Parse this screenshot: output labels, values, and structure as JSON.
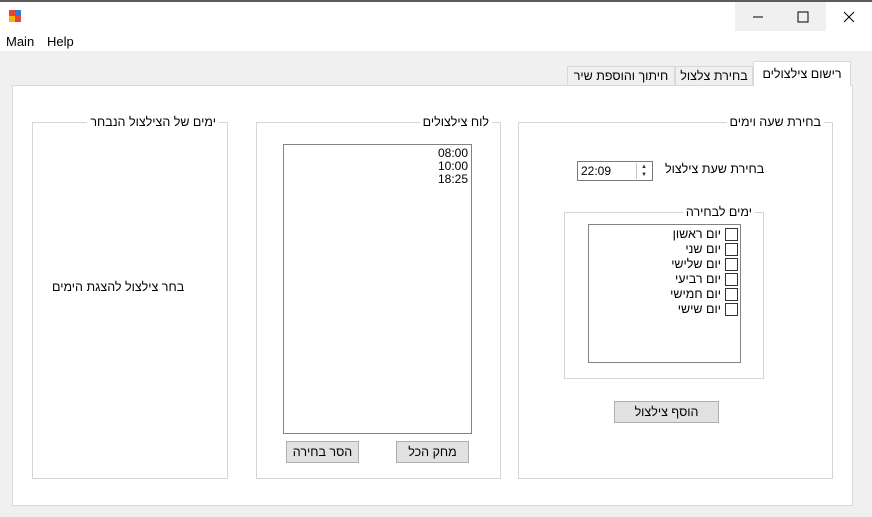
{
  "window": {
    "minimize_glyph": "—",
    "maximize_glyph": "☐",
    "close_glyph": "✕"
  },
  "menu": {
    "items": [
      "Main",
      "Help"
    ]
  },
  "tabs": [
    {
      "label": "רישום צילצולים",
      "active": true
    },
    {
      "label": "בחירת צלצול",
      "active": false
    },
    {
      "label": "חיתוך והוספת שיר",
      "active": false
    }
  ],
  "time_group": {
    "title": "בחירת שעה וימים",
    "time_label": "בחירת שעת צילצול",
    "time_value": "22:09",
    "days_group_title": "ימים לבחירה",
    "days": [
      {
        "label": "יום ראשון",
        "checked": false
      },
      {
        "label": "יום שני",
        "checked": false
      },
      {
        "label": "יום שלישי",
        "checked": false
      },
      {
        "label": "יום רביעי",
        "checked": false
      },
      {
        "label": "יום חמישי",
        "checked": false
      },
      {
        "label": "יום שישי",
        "checked": false
      }
    ],
    "add_button": "הוסף צילצול"
  },
  "schedule_group": {
    "title": "לוח צילצולים",
    "times": [
      "08:00",
      "10:00",
      "18:25"
    ],
    "clear_all_button": "מחק הכל",
    "remove_selected_button": "הסר בחירה"
  },
  "days_group": {
    "title": "ימים של הצילצול הנבחר",
    "placeholder": "בחר צילצול להצגת הימים"
  },
  "colors": {
    "window_bg": "#f0f0f0",
    "panel_bg": "#ffffff",
    "button_bg": "#e1e1e1",
    "border": "#d5d5d5"
  }
}
